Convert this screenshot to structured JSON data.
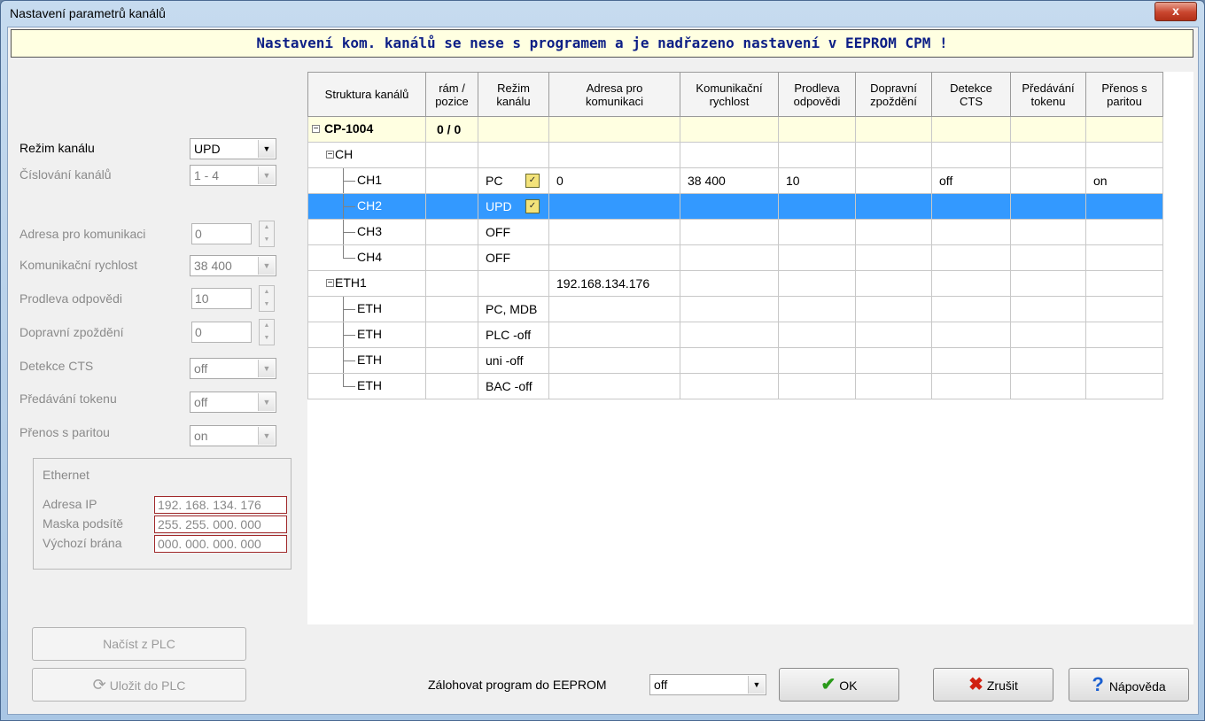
{
  "window": {
    "title": "Nastavení parametrů kanálů",
    "close_glyph": "x"
  },
  "banner": "Nastavení kom. kanálů se nese s programem a je nadřazeno nastavení v EEPROM CPM !",
  "left": {
    "rezim_kanalu": {
      "label": "Režim kanálu",
      "value": "UPD"
    },
    "cislovani": {
      "label": "Číslování kanálů",
      "value": "1 - 4"
    },
    "adresa": {
      "label": "Adresa pro komunikaci",
      "value": "0"
    },
    "rychlost": {
      "label": "Komunikační rychlost",
      "value": "38 400"
    },
    "prodleva": {
      "label": "Prodleva odpovědi",
      "value": "10"
    },
    "zpozdeni": {
      "label": "Dopravní zpoždění",
      "value": "0"
    },
    "cts": {
      "label": "Detekce CTS",
      "value": "off"
    },
    "token": {
      "label": "Předávání tokenu",
      "value": "off"
    },
    "parita": {
      "label": "Přenos s paritou",
      "value": "on"
    },
    "ethernet": {
      "title": "Ethernet",
      "ip_label": "Adresa IP",
      "ip_value": "192. 168. 134. 176",
      "mask_label": "Maska podsítě",
      "mask_value": "255. 255. 000. 000",
      "gw_label": "Výchozí brána",
      "gw_value": "000. 000. 000. 000"
    },
    "nacist_btn": "Načíst z PLC",
    "ulozit_btn": "Uložit do PLC"
  },
  "grid": {
    "headers": {
      "struktura": "Struktura kanálů",
      "ram1": "rám /",
      "ram2": "pozice",
      "rezim1": "Režim",
      "rezim2": "kanálu",
      "adresa1": "Adresa pro",
      "adresa2": "komunikaci",
      "rychlost1": "Komunikační",
      "rychlost2": "rychlost",
      "prodleva1": "Prodleva",
      "prodleva2": "odpovědi",
      "zpozdeni1": "Dopravní",
      "zpozdeni2": "zpoždění",
      "cts1": "Detekce",
      "cts2": "CTS",
      "token1": "Předávání",
      "token2": "tokenu",
      "parita1": "Přenos s",
      "parita2": "paritou"
    },
    "rows": [
      {
        "name": "CP-1004",
        "ram": "0 / 0",
        "rezim": "",
        "adresa": "",
        "rychlost": "",
        "prodleva": "",
        "zpozdeni": "",
        "cts": "",
        "token": "",
        "parita": ""
      },
      {
        "name": "CH",
        "ram": "",
        "rezim": "",
        "adresa": "",
        "rychlost": "",
        "prodleva": "",
        "zpozdeni": "",
        "cts": "",
        "token": "",
        "parita": ""
      },
      {
        "name": "CH1",
        "ram": "",
        "rezim": "PC",
        "adresa": "0",
        "rychlost": "38 400",
        "prodleva": "10",
        "zpozdeni": "",
        "cts": "off",
        "token": "",
        "parita": "on"
      },
      {
        "name": "CH2",
        "ram": "",
        "rezim": "UPD",
        "adresa": "",
        "rychlost": "",
        "prodleva": "",
        "zpozdeni": "",
        "cts": "",
        "token": "",
        "parita": ""
      },
      {
        "name": "CH3",
        "ram": "",
        "rezim": "OFF",
        "adresa": "",
        "rychlost": "",
        "prodleva": "",
        "zpozdeni": "",
        "cts": "",
        "token": "",
        "parita": ""
      },
      {
        "name": "CH4",
        "ram": "",
        "rezim": "OFF",
        "adresa": "",
        "rychlost": "",
        "prodleva": "",
        "zpozdeni": "",
        "cts": "",
        "token": "",
        "parita": ""
      },
      {
        "name": "ETH1",
        "ram": "",
        "rezim": "",
        "adresa": "192.168.134.176",
        "rychlost": "",
        "prodleva": "",
        "zpozdeni": "",
        "cts": "",
        "token": "",
        "parita": ""
      },
      {
        "name": "ETH",
        "ram": "",
        "rezim": "PC, MDB",
        "adresa": "",
        "rychlost": "",
        "prodleva": "",
        "zpozdeni": "",
        "cts": "",
        "token": "",
        "parita": ""
      },
      {
        "name": "ETH",
        "ram": "",
        "rezim": "PLC -off",
        "adresa": "",
        "rychlost": "",
        "prodleva": "",
        "zpozdeni": "",
        "cts": "",
        "token": "",
        "parita": ""
      },
      {
        "name": "ETH",
        "ram": "",
        "rezim": "uni -off",
        "adresa": "",
        "rychlost": "",
        "prodleva": "",
        "zpozdeni": "",
        "cts": "",
        "token": "",
        "parita": ""
      },
      {
        "name": "ETH",
        "ram": "",
        "rezim": "BAC -off",
        "adresa": "",
        "rychlost": "",
        "prodleva": "",
        "zpozdeni": "",
        "cts": "",
        "token": "",
        "parita": ""
      }
    ],
    "selected_row": "CH2"
  },
  "bottom": {
    "eeprom_label": "Zálohovat program do EEPROM",
    "eeprom_value": "off",
    "ok": "OK",
    "zrusit": "Zrušit",
    "napoveda": "Nápověda"
  },
  "colors": {
    "banner_text": "#0d1f86",
    "banner_bg": "#ffffe1",
    "selection": "#3399ff",
    "ip_border": "#a0282a"
  },
  "icons": [
    "check-icon",
    "x-icon",
    "help-icon",
    "refresh-icon",
    "expand-icon",
    "checkbox-icon"
  ]
}
